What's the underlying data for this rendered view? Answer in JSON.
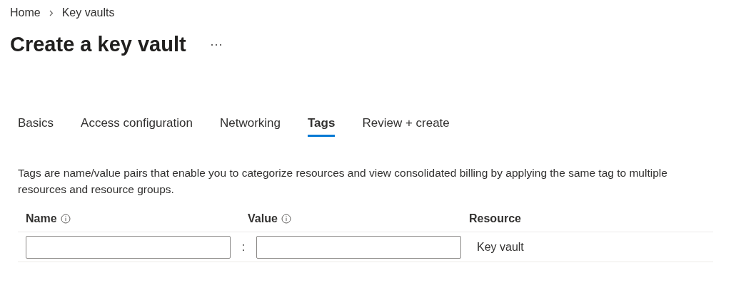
{
  "breadcrumb": [
    "Home",
    "Key vaults"
  ],
  "title": "Create a key vault",
  "tabs": [
    {
      "label": "Basics",
      "selected": false
    },
    {
      "label": "Access configuration",
      "selected": false
    },
    {
      "label": "Networking",
      "selected": false
    },
    {
      "label": "Tags",
      "selected": true
    },
    {
      "label": "Review + create",
      "selected": false
    }
  ],
  "description": "Tags are name/value pairs that enable you to categorize resources and view consolidated billing by applying the same tag to multiple resources and resource groups.",
  "table": {
    "columns": [
      {
        "label": "Name",
        "info": true
      },
      {
        "label": "Value",
        "info": true
      },
      {
        "label": "Resource",
        "info": false
      }
    ],
    "separator": ":",
    "rows": [
      {
        "resource": "Key vault"
      }
    ]
  }
}
